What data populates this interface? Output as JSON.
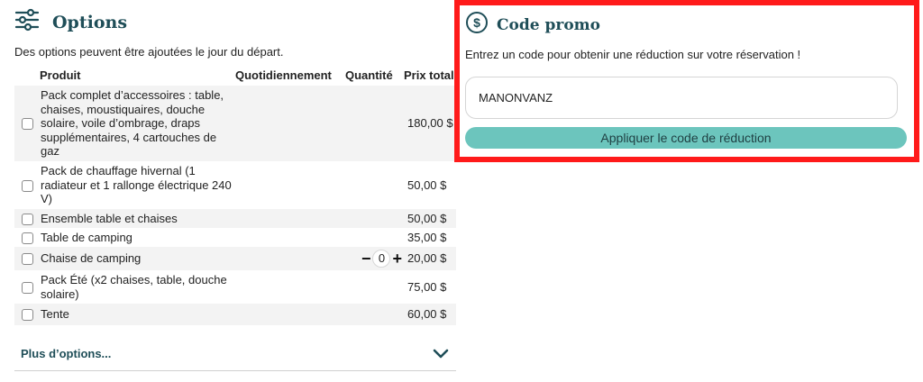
{
  "options": {
    "title": "Options",
    "icon": "sliders-icon",
    "description": "Des options peuvent être ajoutées le jour du départ.",
    "columns": {
      "product": "Produit",
      "daily": "Quotidiennement",
      "quantity": "Quantité",
      "price": "Prix total"
    },
    "items": [
      {
        "name": "Pack complet d’accessoires : table, chaises, moustiquaires, douche solaire, voile d’ombrage, draps supplémentaires, 4 cartouches de gaz",
        "price": "180,00 $",
        "checked": false
      },
      {
        "name": "Pack de chauffage hivernal (1 radiateur et 1 rallonge électrique 240 V)",
        "price": "50,00 $",
        "checked": false
      },
      {
        "name": "Ensemble table et chaises",
        "price": "50,00 $",
        "checked": false
      },
      {
        "name": "Table de camping",
        "price": "35,00 $",
        "checked": false
      },
      {
        "name": "Chaise de camping",
        "price": "20,00 $",
        "checked": false,
        "quantity": {
          "minus": "−",
          "value": "0",
          "plus": "+"
        }
      },
      {
        "name": "Pack Été (x2 chaises, table, douche solaire)",
        "price": "75,00 $",
        "checked": false
      },
      {
        "name": "Tente",
        "price": "60,00 $",
        "checked": false
      }
    ],
    "more_label": "Plus d’options...",
    "more_icon": "chevron-down-icon"
  },
  "promo": {
    "title": "Code promo",
    "icon": "dollar-circle-icon",
    "description": "Entrez un code pour obtenir une réduction sur votre réservation !",
    "input_value": "MANONVANZ",
    "button_label": "Appliquer le code de réduction",
    "highlight_color": "#ff1a1a",
    "button_color": "#6cc5bd",
    "title_color": "#1f4e58"
  }
}
